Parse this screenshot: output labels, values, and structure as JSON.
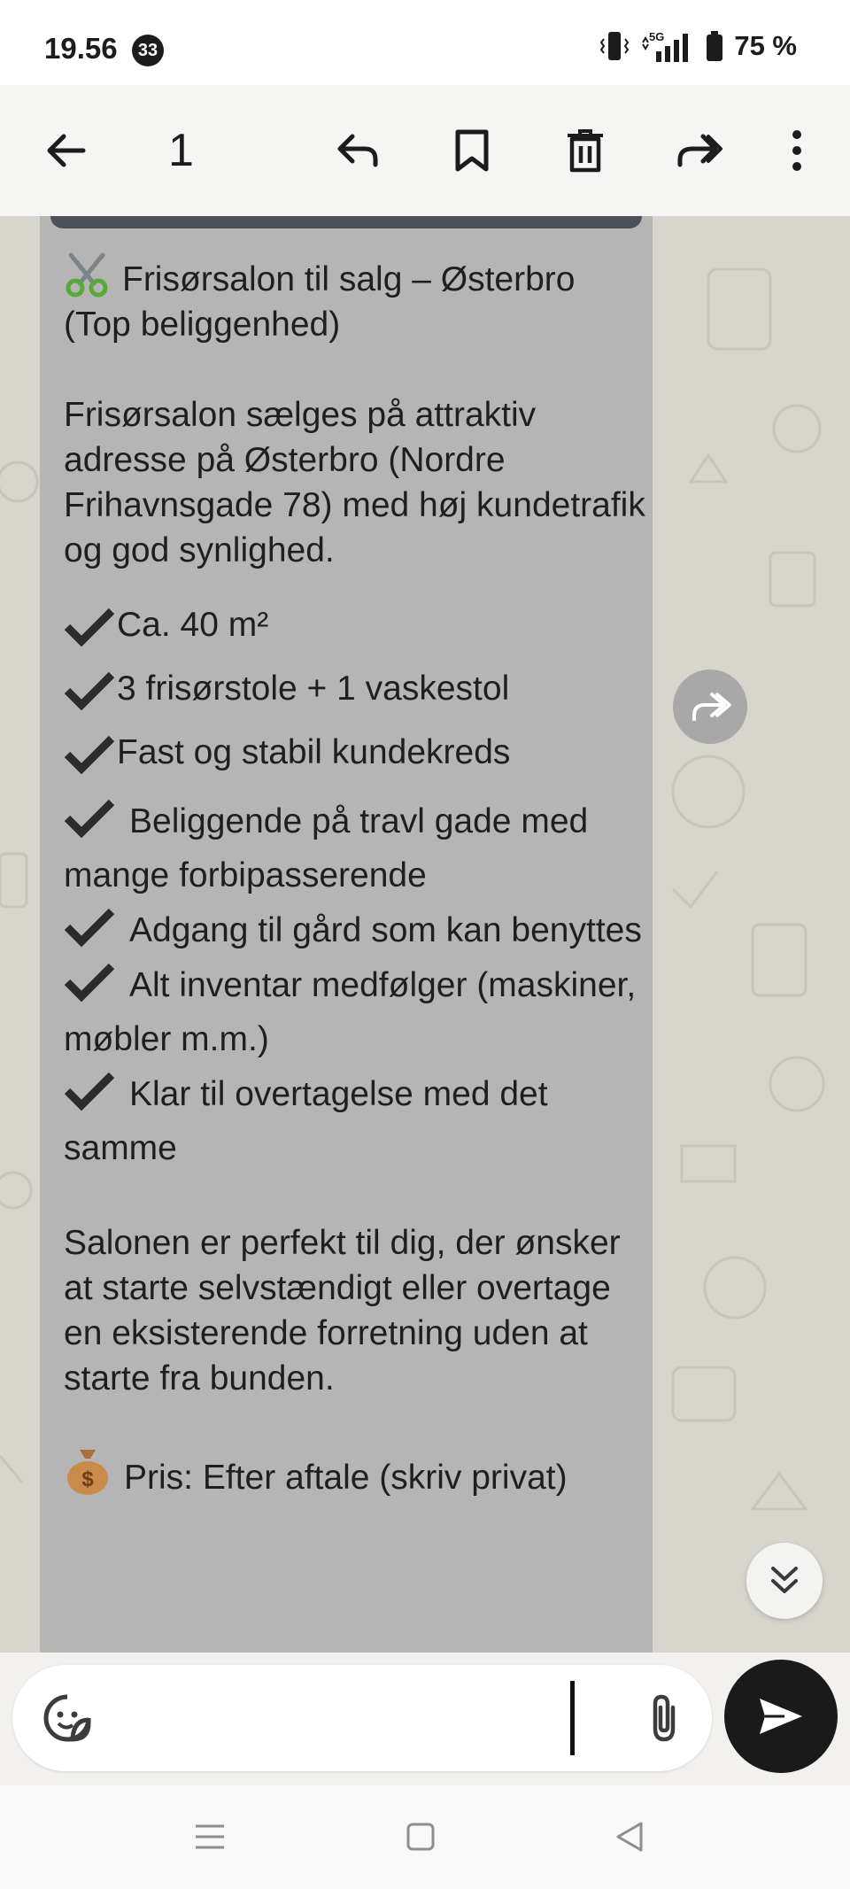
{
  "status_bar": {
    "time": "19.56",
    "notification_count": "33",
    "network": "5G",
    "battery": "75 %"
  },
  "toolbar": {
    "selected_count": "1",
    "icons": [
      "back-arrow-icon",
      "reply-icon",
      "bookmark-icon",
      "delete-icon",
      "forward-icon",
      "more-icon"
    ]
  },
  "message": {
    "title": "Frisørsalon til salg – Østerbro (Top beliggenhed)",
    "intro": "Frisørsalon sælges på attraktiv adresse på Østerbro (Nordre Frihavnsgade 78) med høj kundetrafik og god synlighed.",
    "features": [
      "Ca. 40 m²",
      "3 frisørstole + 1 vaskestol",
      "Fast og stabil kundekreds",
      "Beliggende på travl gade med mange forbipasserende",
      "Adgang til gård som kan benyttes",
      "Alt inventar medfølger (maskiner, møbler m.m.)",
      "Klar til overtagelse med det samme"
    ],
    "description": "Salonen er perfekt til dig, der ønsker at starte selvstændigt eller overtage en eksisterende forretning uden at starte fra bunden.",
    "price": "Pris: Efter aftale (skriv privat)"
  },
  "composer": {
    "input_value": ""
  },
  "colors": {
    "bubble": "#b5b5b5",
    "wallpaper": "#d8d5cd",
    "send_button": "#1a1a1a"
  }
}
